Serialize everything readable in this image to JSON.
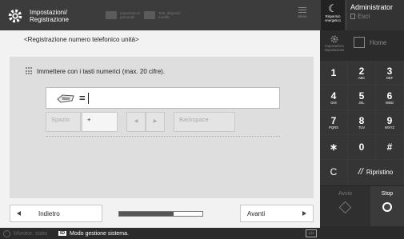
{
  "topbar": {
    "settings_label_1": "Impostazioni/",
    "settings_label_2": "Registrazione",
    "shortcut1_line1": "Impostazioni",
    "shortcut1_line2": "personali",
    "shortcut2_line1": "Tast. disposiz.",
    "shortcut2_line2": "modific",
    "menu_label": "Menu",
    "energy_line1": "Risparmio",
    "energy_line2": "energetico",
    "admin_name": "Administrator",
    "logout_label": "Esci"
  },
  "main": {
    "breadcrumb": "<Registrazione numero telefonico unità>",
    "instruction": "Immettere con i tasti numerici (max. 20 cifre).",
    "input_prefix": "=",
    "input_value": "",
    "keys": {
      "spazio": "Spazio",
      "plus": "+",
      "backspace": "Backspace",
      "left_arrow": "◀",
      "right_arrow": "▶"
    },
    "back_label": "Indietro",
    "next_label": "Avanti",
    "progress_fraction": 0.65
  },
  "right": {
    "reset_settings_line1": "Impostazioni",
    "reset_settings_line2": "Impostazione",
    "home_label": "Home",
    "keypad": [
      {
        "d": "1",
        "s": ""
      },
      {
        "d": "2",
        "s": "ABC"
      },
      {
        "d": "3",
        "s": "DEF"
      },
      {
        "d": "4",
        "s": "GHI"
      },
      {
        "d": "5",
        "s": "JKL"
      },
      {
        "d": "6",
        "s": "MNO"
      },
      {
        "d": "7",
        "s": "PQRS"
      },
      {
        "d": "8",
        "s": "TUV"
      },
      {
        "d": "9",
        "s": "WXYZ"
      },
      {
        "d": "∗",
        "s": ""
      },
      {
        "d": "0",
        "s": ""
      },
      {
        "d": "#",
        "s": ""
      }
    ],
    "clear_label": "C",
    "reset_label": "Ripristino",
    "start_label": "Avvio",
    "stop_label": "Stop"
  },
  "statusbar": {
    "monitor_label": "Monitor. stato",
    "id_badge": "ID",
    "message": "Modo gestione sistema.",
    "keyboard_badge": "123"
  }
}
